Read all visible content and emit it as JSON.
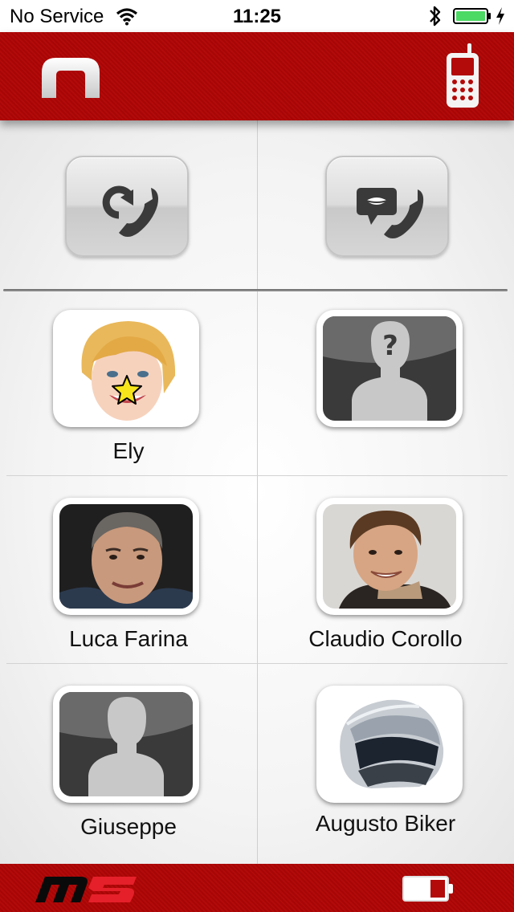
{
  "status_bar": {
    "carrier": "No Service",
    "time": "11:25",
    "wifi_icon": "wifi-icon",
    "bluetooth_icon": "bluetooth-icon",
    "battery_icon": "battery-icon",
    "battery_color": "#4cd964"
  },
  "header": {
    "logo_icon": "brand-logo",
    "phone_icon": "mobile-phone-icon",
    "color": "#b30a0a"
  },
  "actions": [
    {
      "icon": "redial-icon"
    },
    {
      "icon": "voice-call-icon"
    }
  ],
  "contacts": [
    {
      "name": "Ely",
      "avatar": "photo-blonde-woman",
      "favorite": true
    },
    {
      "name": "",
      "avatar": "unknown-contact-silhouette",
      "favorite": false
    },
    {
      "name": "Luca Farina",
      "avatar": "photo-man-grey-hair",
      "favorite": false
    },
    {
      "name": "Claudio Corollo",
      "avatar": "photo-man-brown-hair",
      "favorite": false
    },
    {
      "name": "Giuseppe",
      "avatar": "contact-silhouette",
      "favorite": false
    },
    {
      "name": "Augusto Biker",
      "avatar": "photo-motorcycle-helmet",
      "favorite": false
    }
  ],
  "footer": {
    "brand_icon": "m5-logo",
    "device_battery_icon": "device-battery-icon"
  }
}
